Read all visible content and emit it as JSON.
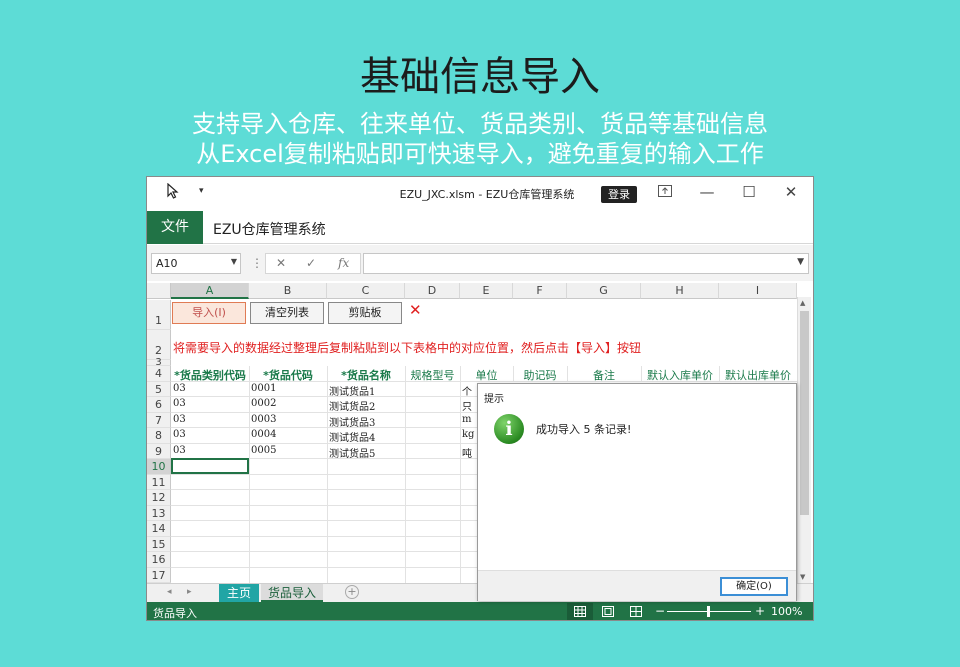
{
  "promo": {
    "title": "基础信息导入",
    "line1": "支持导入仓库、往来单位、货品类别、货品等基础信息",
    "line2": "从Excel复制粘贴即可快速导入，避免重复的输入工作"
  },
  "window": {
    "title": "EZU_JXC.xlsm  -  EZU仓库管理系统",
    "login_label": "登录",
    "file_tab": "文件",
    "app_name": "EZU仓库管理系统"
  },
  "formula_bar": {
    "name_box": "A10",
    "cancel_symbol": "✕",
    "enter_symbol": "✓",
    "function_symbol": "fx",
    "formula_value": ""
  },
  "columns": [
    "A",
    "B",
    "C",
    "D",
    "E",
    "F",
    "G",
    "H",
    "I"
  ],
  "selected_column": "A",
  "rows": [
    "1",
    "2",
    "3",
    "4",
    "5",
    "6",
    "7",
    "8",
    "9",
    "10",
    "11",
    "12",
    "13",
    "14",
    "15",
    "16",
    "17"
  ],
  "selected_row": "10",
  "sheet_buttons": {
    "import": "导入(I)",
    "clear": "清空列表",
    "clipboard": "剪贴板",
    "close": "✕"
  },
  "instruction": "将需要导入的数据经过整理后复制粘贴到以下表格中的对应位置，然后点击【导入】按钮",
  "table_headers": [
    "*货品类别代码",
    "*货品代码",
    "*货品名称",
    "规格型号",
    "单位",
    "助记码",
    "备注",
    "默认入库单价",
    "默认出库单价"
  ],
  "table_rows": [
    {
      "category": "03",
      "code": "0001",
      "name": "测试货品1",
      "unit": "个"
    },
    {
      "category": "03",
      "code": "0002",
      "name": "测试货品2",
      "unit": "只"
    },
    {
      "category": "03",
      "code": "0003",
      "name": "测试货品3",
      "unit": "m"
    },
    {
      "category": "03",
      "code": "0004",
      "name": "测试货品4",
      "unit": "kg"
    },
    {
      "category": "03",
      "code": "0005",
      "name": "测试货品5",
      "unit": "吨"
    }
  ],
  "sheet_tabs": {
    "home": "主页",
    "import": "货品导入",
    "add": "+"
  },
  "status_bar": {
    "sheet_label": "货品导入",
    "zoom_minus": "−",
    "zoom_plus": "+",
    "zoom": "100%"
  },
  "dialog": {
    "title": "提示",
    "icon": "info-icon",
    "message": "成功导入 5 条记录!",
    "ok_label": "确定(O)"
  },
  "colors": {
    "background": "#5ddcd6",
    "excel_green": "#217346",
    "alert_red": "#e02020",
    "header_green": "#1a7a4a"
  }
}
